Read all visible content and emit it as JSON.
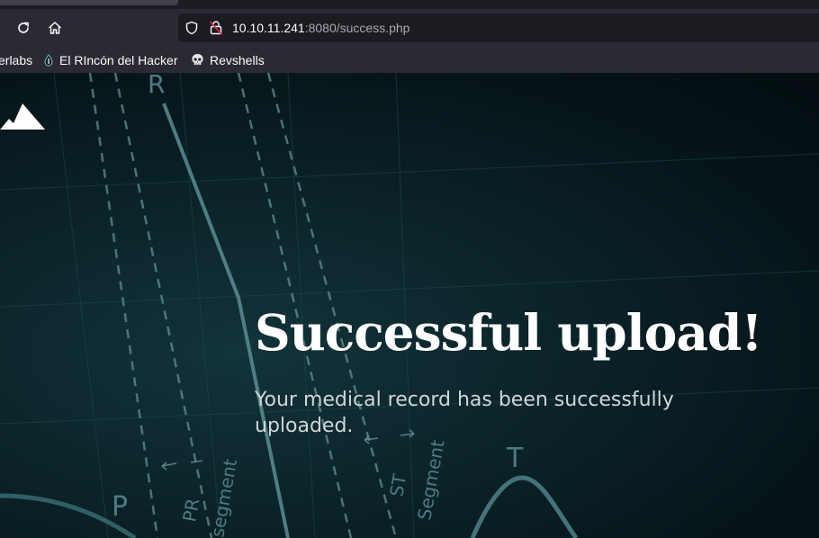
{
  "browser": {
    "url": {
      "host": "10.10.11.241",
      "rest": ":8080/success.php"
    },
    "bookmarks": [
      {
        "label": "erlabs",
        "icon": "none"
      },
      {
        "label": "El RIncón del Hacker",
        "icon": "drop-icon"
      },
      {
        "label": "Revshells",
        "icon": "skull-icon"
      }
    ]
  },
  "page": {
    "headline": "Successful upload!",
    "message": "Your medical record has been successfully uploaded.",
    "background_labels": {
      "r": "R",
      "p": "P",
      "t": "T",
      "pr": "PR",
      "pr_segment": "segment",
      "st": "ST",
      "st_segment": "Segment"
    }
  },
  "colors": {
    "toolbar": "#2b2a33",
    "urlbar": "#1c1b22",
    "page_dark": "#061419",
    "headline": "#ffffff",
    "message": "#d0d6d8"
  }
}
